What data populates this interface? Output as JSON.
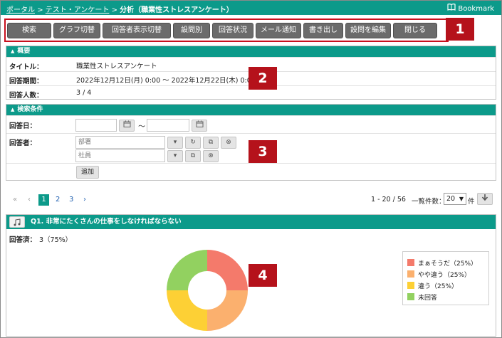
{
  "breadcrumb": {
    "portal": "ポータル",
    "sep1": ">",
    "survey": "テスト・アンケート",
    "sep2": ">",
    "current": "分析（職業性ストレスアンケート）"
  },
  "bookmark": {
    "label": "Bookmark",
    "icon": "book-icon"
  },
  "toolbar": {
    "buttons": [
      "検索",
      "グラフ切替",
      "回答者表示切替",
      "設問別",
      "回答状況",
      "メール通知",
      "書き出し",
      "設問を編集",
      "閉じる"
    ]
  },
  "tags": [
    "1",
    "2",
    "3",
    "4"
  ],
  "overview": {
    "header": "概要",
    "title_label": "タイトル：",
    "title_value": "職業性ストレスアンケート",
    "period_label": "回答期間：",
    "period_value": "2022年12月12日(月) 0:00 ～ 2022年12月22日(木) 0:00",
    "count_label": "回答人数：",
    "count_value": "3 / 4"
  },
  "search": {
    "header": "検索条件",
    "date_label": "回答日：",
    "date_from": "",
    "tilde": "～",
    "date_to": "",
    "respondent_label": "回答者：",
    "dept_placeholder": "部署",
    "user_placeholder": "社員",
    "add_label": "追加"
  },
  "pagination": {
    "first": "«",
    "prev": "‹",
    "pages": [
      "1",
      "2",
      "3"
    ],
    "current": "1",
    "next": "›",
    "range": "1 - 20 / 56",
    "per_page_label": "一覧件数：",
    "per_page_value": "20",
    "unit": "件"
  },
  "question": {
    "title": "Q1. 非常にたくさんの仕事をしなければならない",
    "answered_label": "回答済：",
    "answered_value": "3（75%）"
  },
  "chart_data": {
    "type": "pie",
    "variant": "donut",
    "categories": [
      "まぁそうだ（25%）",
      "やや違う（25%）",
      "違う（25%）",
      "未回答"
    ],
    "values": [
      25,
      25,
      25,
      25
    ],
    "colors": [
      "#f47a6b",
      "#fbb06e",
      "#fdd035",
      "#92d160"
    ],
    "legend_position": "right"
  },
  "colors": {
    "accent": "#0c9a8a",
    "toolbar_button": "#6b6b6b",
    "tag": "#b5121b"
  }
}
